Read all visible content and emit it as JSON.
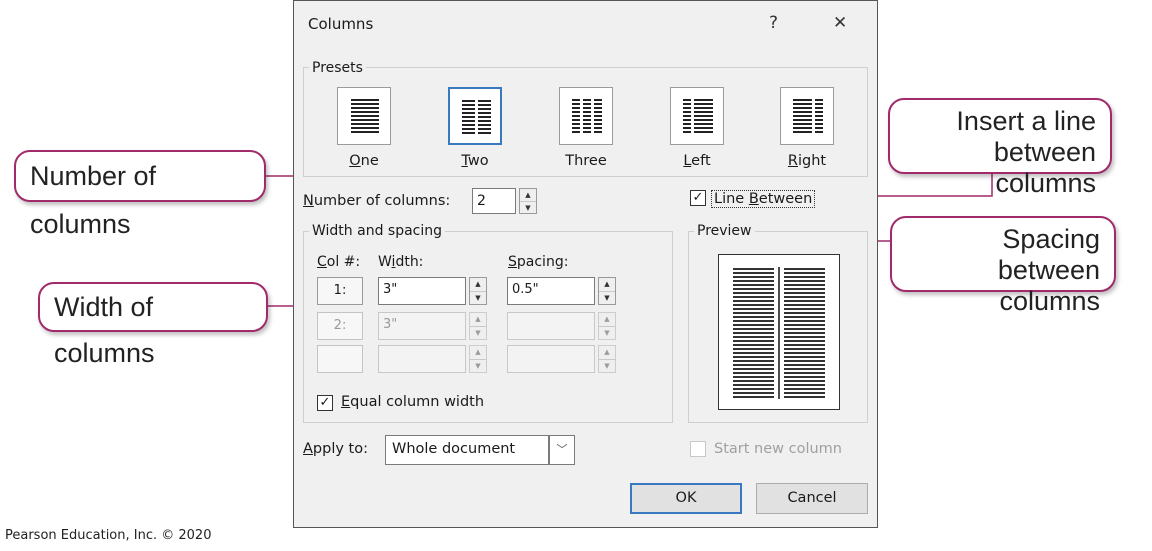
{
  "dialog": {
    "title": "Columns",
    "help": "?",
    "close": "✕",
    "presets": {
      "label": "Presets",
      "items": [
        {
          "key": "O",
          "rest": "ne"
        },
        {
          "key": "T",
          "rest": "wo",
          "selected": true
        },
        {
          "key": "",
          "rest": "Three"
        },
        {
          "key": "L",
          "rest": "eft"
        },
        {
          "key": "R",
          "rest": "ight"
        }
      ]
    },
    "number_of_columns": {
      "key": "N",
      "label": "umber of columns:",
      "value": "2"
    },
    "line_between": {
      "key": "B",
      "label_pre": "Line ",
      "label_post": "etween",
      "checked": true
    },
    "width_spacing": {
      "label": "Width and spacing",
      "col_header": {
        "key": "C",
        "rest": "ol #:"
      },
      "width_header": {
        "pre": "W",
        "key": "i",
        "rest": "dth:"
      },
      "spacing_header": {
        "key": "S",
        "rest": "pacing:"
      },
      "rows": [
        {
          "col": "1:",
          "width": "3\"",
          "spacing": "0.5\""
        },
        {
          "col": "2:",
          "width": "3\"",
          "spacing": ""
        },
        {
          "col": "",
          "width": "",
          "spacing": ""
        }
      ]
    },
    "equal_width": {
      "key": "E",
      "label": "qual column width",
      "checked": true
    },
    "preview": {
      "label": "Preview"
    },
    "apply_to": {
      "key": "A",
      "label": "pply to:",
      "value": "Whole document"
    },
    "start_new_column": {
      "label": "Start new column",
      "checked": false
    },
    "ok": "OK",
    "cancel": "Cancel"
  },
  "callouts": {
    "number": "Number of columns",
    "width": "Width of columns",
    "line": [
      "Insert a line",
      "between columns"
    ],
    "spacing": [
      "Spacing between",
      "columns"
    ]
  },
  "credit": "Pearson Education, Inc. © 2020",
  "colors": {
    "accent": "#3a78c2",
    "callout_border": "#a02a6a"
  }
}
